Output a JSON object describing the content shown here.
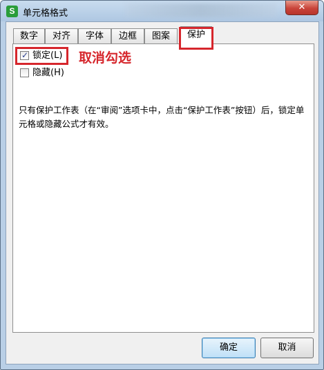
{
  "window": {
    "title": "单元格格式",
    "app_icon_glyph": "S",
    "close_glyph": "✕"
  },
  "tabs": [
    {
      "label": "数字",
      "active": false
    },
    {
      "label": "对齐",
      "active": false
    },
    {
      "label": "字体",
      "active": false
    },
    {
      "label": "边框",
      "active": false
    },
    {
      "label": "图案",
      "active": false
    },
    {
      "label": "保护",
      "active": true
    }
  ],
  "protection": {
    "locked": {
      "label": "锁定(L)",
      "checked": true
    },
    "hidden": {
      "label": "隐藏(H)",
      "checked": false
    },
    "description": "只有保护工作表（在“审阅”选项卡中，点击“保护工作表”按钮）后，锁定单元格或隐藏公式才有效。"
  },
  "annotation": {
    "text": "取消勾选",
    "color": "#d6262c"
  },
  "buttons": {
    "ok": "确定",
    "cancel": "取消"
  },
  "colors": {
    "highlight": "#d6262c",
    "app_icon": "#2a9d3a",
    "close_button": "#c9443a"
  }
}
